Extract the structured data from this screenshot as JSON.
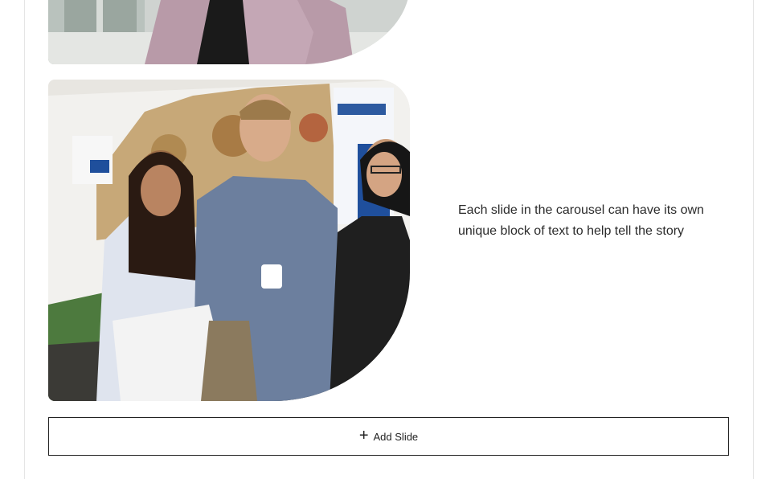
{
  "slides": [
    {
      "image": "women-portrait-photo"
    },
    {
      "image": "students-group-photo",
      "text": "Each slide in the carousel can have its own unique block of text to help tell the story"
    }
  ],
  "add_slide": {
    "label": "Add Slide",
    "icon": "plus-icon"
  },
  "colors": {
    "border": "#222222",
    "text": "#2b2b2b",
    "card_border": "#e5e5e5"
  }
}
